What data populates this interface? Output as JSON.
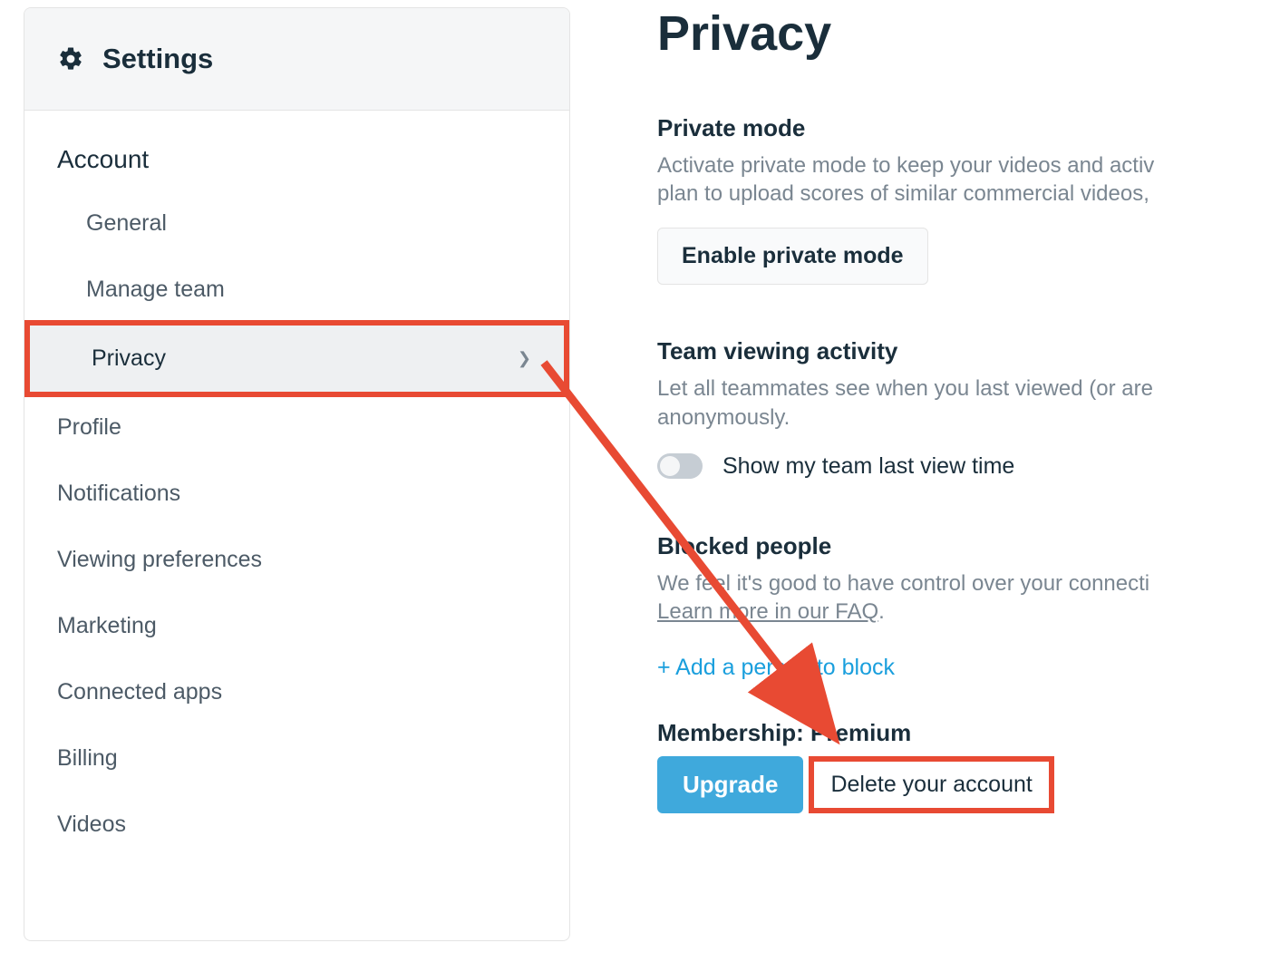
{
  "sidebar": {
    "title": "Settings",
    "sections": [
      {
        "heading": "Account",
        "items": [
          {
            "label": "General",
            "active": false
          },
          {
            "label": "Manage team",
            "active": false
          },
          {
            "label": "Privacy",
            "active": true,
            "highlighted": true
          }
        ]
      }
    ],
    "top_items": [
      {
        "label": "Profile"
      },
      {
        "label": "Notifications"
      },
      {
        "label": "Viewing preferences"
      },
      {
        "label": "Marketing"
      },
      {
        "label": "Connected apps"
      },
      {
        "label": "Billing"
      },
      {
        "label": "Videos"
      }
    ]
  },
  "main": {
    "title": "Privacy",
    "private_mode": {
      "heading": "Private mode",
      "desc_line1": "Activate private mode to keep your videos and activ",
      "desc_line2": "plan to upload scores of similar commercial videos,",
      "button": "Enable private mode"
    },
    "team_activity": {
      "heading": "Team viewing activity",
      "desc_line1": "Let all teammates see when you last viewed (or are",
      "desc_line2": "anonymously.",
      "toggle_label": "Show my team last view time",
      "toggle_on": false
    },
    "blocked": {
      "heading": "Blocked people",
      "desc": "We feel it's good to have control over your connecti",
      "faq": "Learn more in our FAQ",
      "add": "+ Add a person to block"
    },
    "membership": {
      "heading": "Membership: Premium",
      "upgrade": "Upgrade",
      "delete": "Delete your account"
    }
  },
  "annotations": {
    "privacy_highlight": true,
    "delete_highlight": true,
    "arrow": true
  }
}
